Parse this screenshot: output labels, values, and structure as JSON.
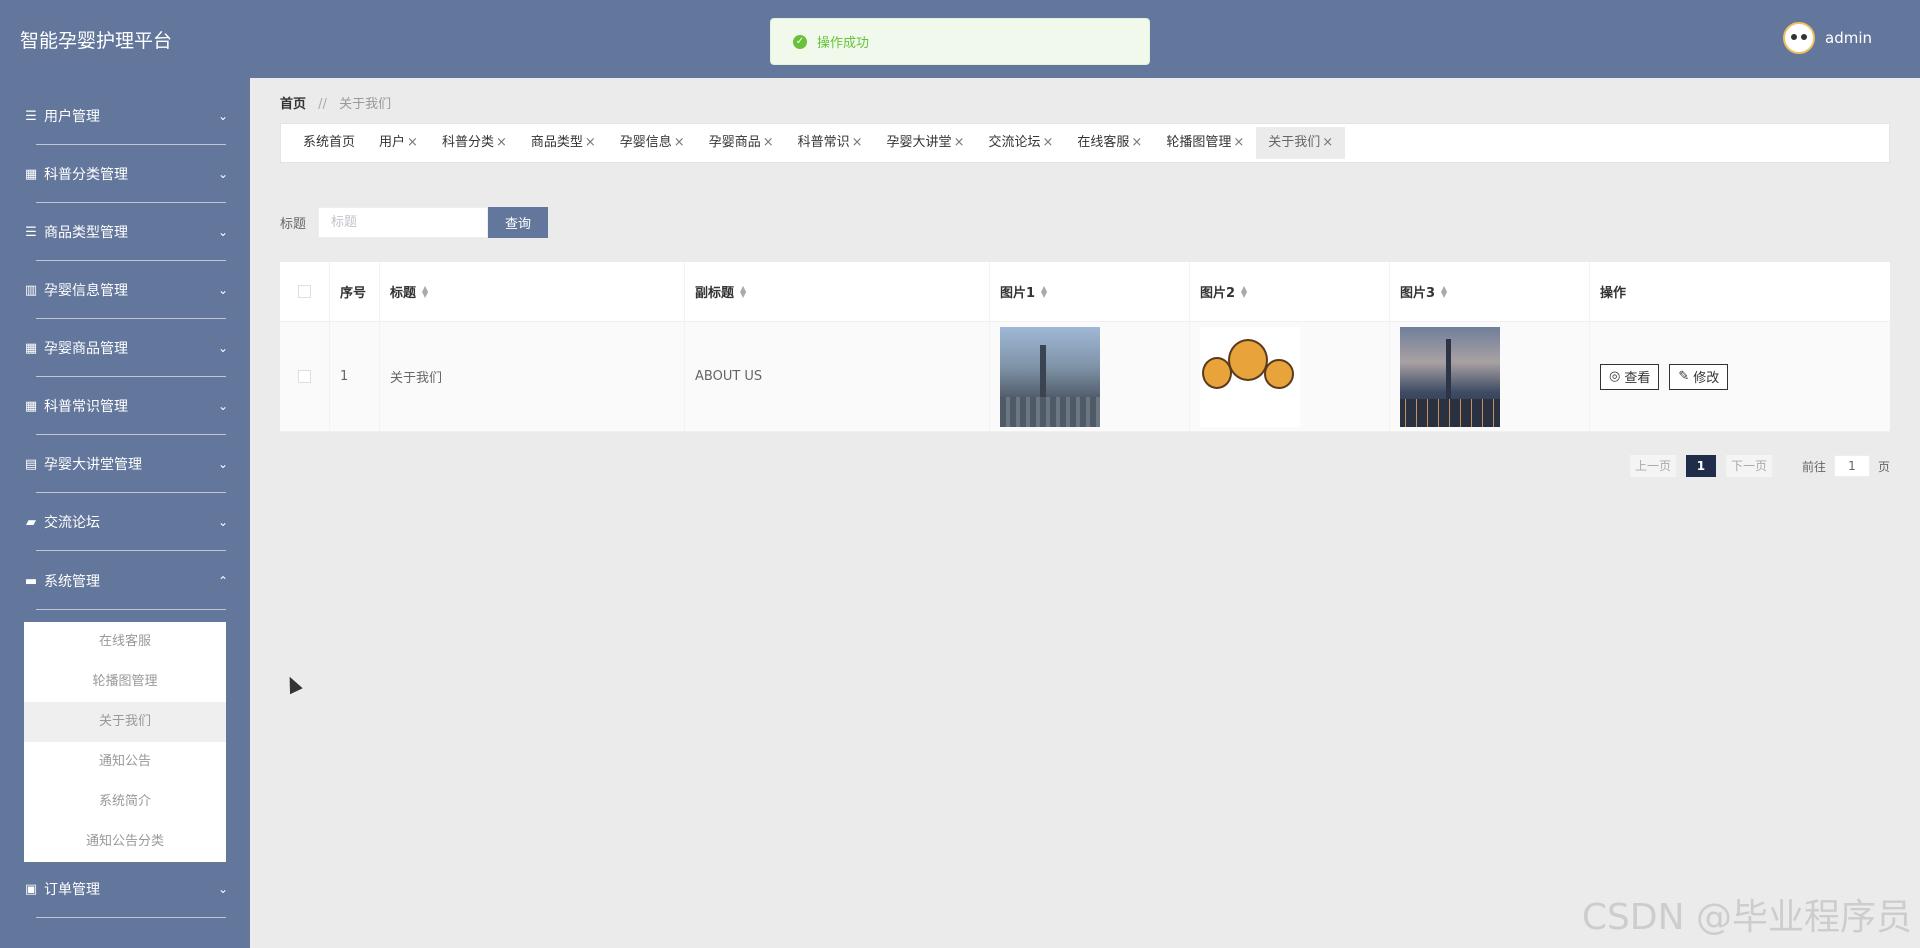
{
  "app": {
    "title": "智能孕婴护理平台"
  },
  "user": {
    "name": "admin"
  },
  "toast": {
    "message": "操作成功"
  },
  "sidebar": {
    "items": [
      {
        "label": "用户管理",
        "icon": "list-icon",
        "chevron": "⌄"
      },
      {
        "label": "科普分类管理",
        "icon": "grid-icon",
        "chevron": "⌄"
      },
      {
        "label": "商品类型管理",
        "icon": "list-icon",
        "chevron": "⌄"
      },
      {
        "label": "孕婴信息管理",
        "icon": "columns-icon",
        "chevron": "⌄"
      },
      {
        "label": "孕婴商品管理",
        "icon": "grid-icon",
        "chevron": "⌄"
      },
      {
        "label": "科普常识管理",
        "icon": "grid-icon",
        "chevron": "⌄"
      },
      {
        "label": "孕婴大讲堂管理",
        "icon": "clipboard-icon",
        "chevron": "⌄"
      },
      {
        "label": "交流论坛",
        "icon": "forum-icon",
        "chevron": "⌄"
      },
      {
        "label": "系统管理",
        "icon": "briefcase-icon",
        "chevron": "⌃"
      },
      {
        "label": "订单管理",
        "icon": "order-icon",
        "chevron": "⌄"
      }
    ],
    "submenu": [
      "在线客服",
      "轮播图管理",
      "关于我们",
      "通知公告",
      "系统简介",
      "通知公告分类"
    ],
    "active_sub": "关于我们"
  },
  "breadcrumb": {
    "home": "首页",
    "separator": "//",
    "current": "关于我们"
  },
  "tabs": [
    {
      "label": "系统首页",
      "closable": false
    },
    {
      "label": "用户",
      "closable": true
    },
    {
      "label": "科普分类",
      "closable": true
    },
    {
      "label": "商品类型",
      "closable": true
    },
    {
      "label": "孕婴信息",
      "closable": true
    },
    {
      "label": "孕婴商品",
      "closable": true
    },
    {
      "label": "科普常识",
      "closable": true
    },
    {
      "label": "孕婴大讲堂",
      "closable": true
    },
    {
      "label": "交流论坛",
      "closable": true
    },
    {
      "label": "在线客服",
      "closable": true
    },
    {
      "label": "轮播图管理",
      "closable": true
    },
    {
      "label": "关于我们",
      "closable": true,
      "active": true
    }
  ],
  "search": {
    "label": "标题",
    "placeholder": "标题",
    "button": "查询"
  },
  "table": {
    "headers": [
      "序号",
      "标题",
      "副标题",
      "图片1",
      "图片2",
      "图片3",
      "操作"
    ],
    "rows": [
      {
        "index": "1",
        "title": "关于我们",
        "subtitle": "ABOUT US"
      }
    ],
    "actions": {
      "view": "查看",
      "edit": "修改"
    }
  },
  "pagination": {
    "prev": "上一页",
    "current": "1",
    "next": "下一页",
    "goto_label": "前往",
    "goto_value": "1",
    "unit": "页"
  },
  "watermark": "CSDN @毕业程序员",
  "colors": {
    "primary": "#63779c",
    "success": "#67c23a",
    "page_active": "#1f2d4a"
  }
}
